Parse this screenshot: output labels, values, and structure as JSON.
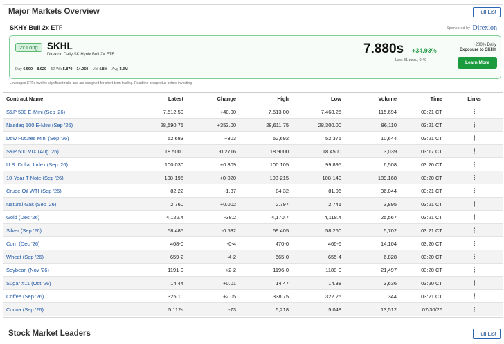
{
  "panel": {
    "title": "Major Markets Overview",
    "full_list_label": "Full List"
  },
  "sponsor": {
    "etf_heading": "SKHY Bull 2x ETF",
    "sponsored_by": "Sponsored by",
    "brand": "Direxion"
  },
  "etf": {
    "badge": "2x Long",
    "ticker": "SKHL",
    "fund_name": "Direxion Daily SK Hynix Bull 2X ETF",
    "day_label": "Day",
    "day_range": "6.590 – 8.020",
    "wk52_label": "52 Wk",
    "wk52_range": "5.870 – 14.060",
    "vol_label": "Vol",
    "vol": "4.8M",
    "avg_label": "Avg",
    "avg": "3.3M",
    "price": "7.880s",
    "change_pct": "+34.93%",
    "last_time": "Last 31 июл., 0:40",
    "exposure_line1": "+200% Daily",
    "exposure_line2": "Exposure to SKHY",
    "learn_more": "Learn More",
    "accent_color": "#1a9c3e"
  },
  "disclaimer": "Leveraged ETFs involve significant risks and are designed for short-term trading. Read the prospectus before investing.",
  "table": {
    "headers": {
      "contract": "Contract Name",
      "latest": "Latest",
      "change": "Change",
      "high": "High",
      "low": "Low",
      "volume": "Volume",
      "time": "Time",
      "links": "Links"
    },
    "rows": [
      {
        "name": "S&P 500 E-Mini (Sep '26)",
        "latest": "7,512.50",
        "change": "+40.00",
        "dir": "up",
        "high": "7,513.00",
        "low": "7,468.25",
        "volume": "115,694",
        "time": "03:21 CT"
      },
      {
        "name": "Nasdaq 100 E-Mini (Sep '26)",
        "latest": "28,590.75",
        "change": "+353.00",
        "dir": "up",
        "high": "28,611.75",
        "low": "28,300.00",
        "volume": "86,110",
        "time": "03:21 CT"
      },
      {
        "name": "Dow Futures Mini (Sep '26)",
        "latest": "52,683",
        "change": "+303",
        "dir": "up",
        "high": "52,692",
        "low": "52,375",
        "volume": "10,644",
        "time": "03:21 CT"
      },
      {
        "name": "S&P 500 VIX (Aug '26)",
        "latest": "18.5000",
        "change": "-0.2716",
        "dir": "down",
        "high": "18.9000",
        "low": "18.4500",
        "volume": "3,039",
        "time": "03:17 CT"
      },
      {
        "name": "U.S. Dollar Index (Sep '26)",
        "latest": "100.030",
        "change": "+0.309",
        "dir": "up",
        "high": "100.105",
        "low": "99.895",
        "volume": "6,508",
        "time": "03:20 CT"
      },
      {
        "name": "10-Year T-Note (Sep '26)",
        "latest": "108-195",
        "change": "+0-020",
        "dir": "up",
        "high": "108-215",
        "low": "108-140",
        "volume": "189,168",
        "time": "03:20 CT"
      },
      {
        "name": "Crude Oil WTI (Sep '26)",
        "latest": "82.22",
        "change": "-1.37",
        "dir": "down",
        "high": "84.32",
        "low": "81.06",
        "volume": "36,044",
        "time": "03:21 CT"
      },
      {
        "name": "Natural Gas (Sep '26)",
        "latest": "2.760",
        "change": "+0.002",
        "dir": "up",
        "high": "2.797",
        "low": "2.741",
        "volume": "3,895",
        "time": "03:21 CT"
      },
      {
        "name": "Gold (Dec '26)",
        "latest": "4,122.4",
        "change": "-38.2",
        "dir": "down",
        "high": "4,170.7",
        "low": "4,118.4",
        "volume": "25,567",
        "time": "03:21 CT"
      },
      {
        "name": "Silver (Sep '26)",
        "latest": "58.485",
        "change": "-0.532",
        "dir": "down",
        "high": "59.405",
        "low": "58.260",
        "volume": "5,702",
        "time": "03:21 CT"
      },
      {
        "name": "Corn (Dec '26)",
        "latest": "468-0",
        "change": "-0-4",
        "dir": "down",
        "high": "470-0",
        "low": "466-6",
        "volume": "14,104",
        "time": "03:20 CT"
      },
      {
        "name": "Wheat (Sep '26)",
        "latest": "659-2",
        "change": "-4-2",
        "dir": "down",
        "high": "665-0",
        "low": "655-4",
        "volume": "6,828",
        "time": "03:20 CT"
      },
      {
        "name": "Soybean (Nov '26)",
        "latest": "1191-0",
        "change": "+2-2",
        "dir": "up",
        "high": "1196-0",
        "low": "1188-0",
        "volume": "21,497",
        "time": "03:20 CT"
      },
      {
        "name": "Sugar #11 (Oct '26)",
        "latest": "14.44",
        "change": "+0.01",
        "dir": "up",
        "high": "14.47",
        "low": "14.38",
        "volume": "3,636",
        "time": "03:20 CT"
      },
      {
        "name": "Coffee (Sep '26)",
        "latest": "325.10",
        "change": "+2.05",
        "dir": "up",
        "high": "338.75",
        "low": "322.25",
        "volume": "344",
        "time": "03:21 CT"
      },
      {
        "name": "Cocoa (Sep '26)",
        "latest": "5,112s",
        "change": "-73",
        "dir": "down",
        "high": "5,218",
        "low": "5,048",
        "volume": "13,512",
        "time": "07/30/26"
      }
    ],
    "links_glyph": "⋮",
    "up_color": "#2a9d4b",
    "down_color": "#d0362d"
  },
  "panel2": {
    "title": "Stock Market Leaders",
    "full_list_label": "Full List"
  }
}
